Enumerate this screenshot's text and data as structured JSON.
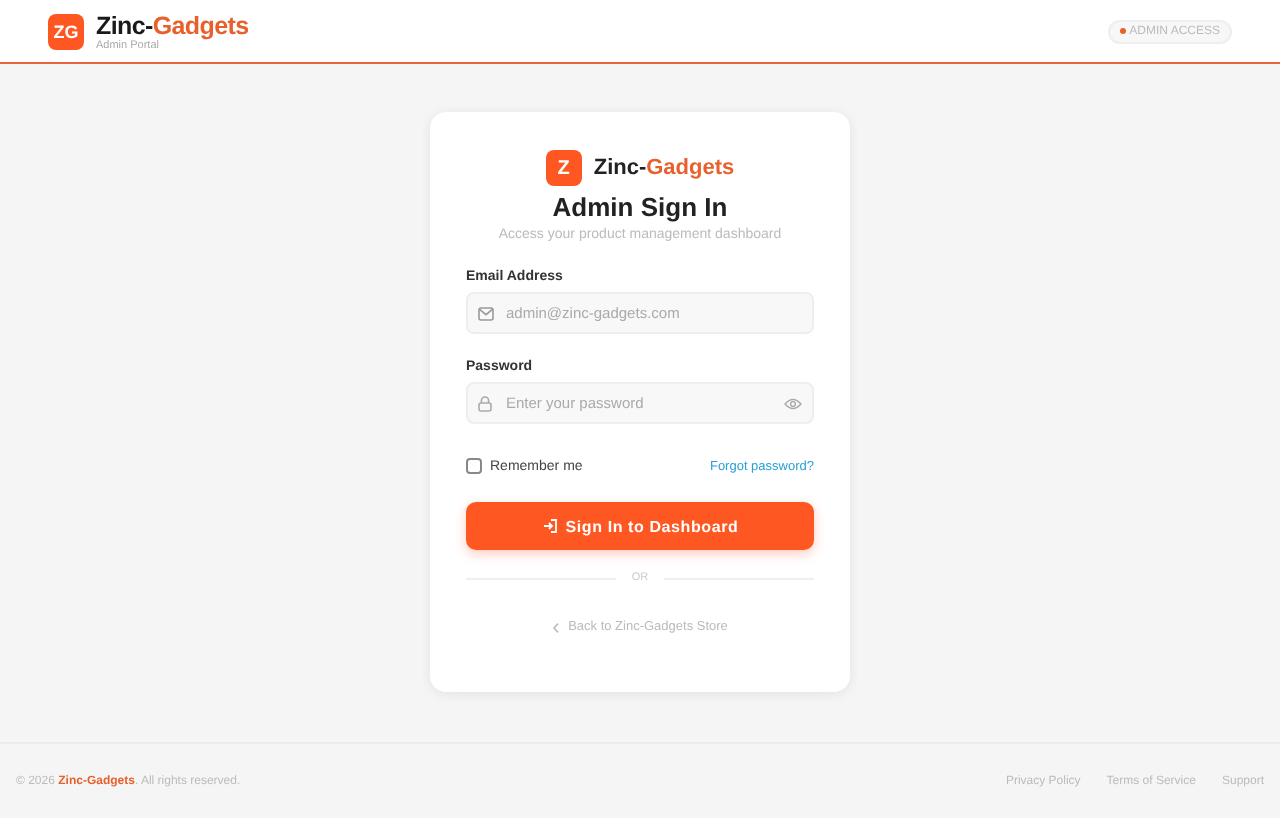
{
  "header": {
    "logo": "ZG",
    "brand_start": "Zinc-",
    "brand_end": "Gadgets",
    "subtitle": "Admin Portal",
    "badge": "ADMIN ACCESS"
  },
  "card": {
    "logo": "Z",
    "brand_start": "Zinc-",
    "brand_end": "Gadgets",
    "title": "Admin Sign In",
    "subtitle": "Access your product management dashboard",
    "fields": [
      {
        "kind": "email",
        "label": "Email Address",
        "placeholder": "admin@zinc-gadgets.com"
      },
      {
        "kind": "password",
        "label": "Password",
        "placeholder": "Enter your password"
      }
    ],
    "remember": {
      "label": "Remember me",
      "checked": false
    },
    "forgot": "Forgot password?",
    "submit": "Sign In to Dashboard",
    "divider": "OR",
    "back": "Back to Zinc-Gadgets Store"
  },
  "footer": {
    "copyright": "© 2026 **Zinc-Gadgets**. All rights reserved.",
    "links": [
      "Privacy Policy",
      "Terms of Service",
      "Support"
    ]
  }
}
